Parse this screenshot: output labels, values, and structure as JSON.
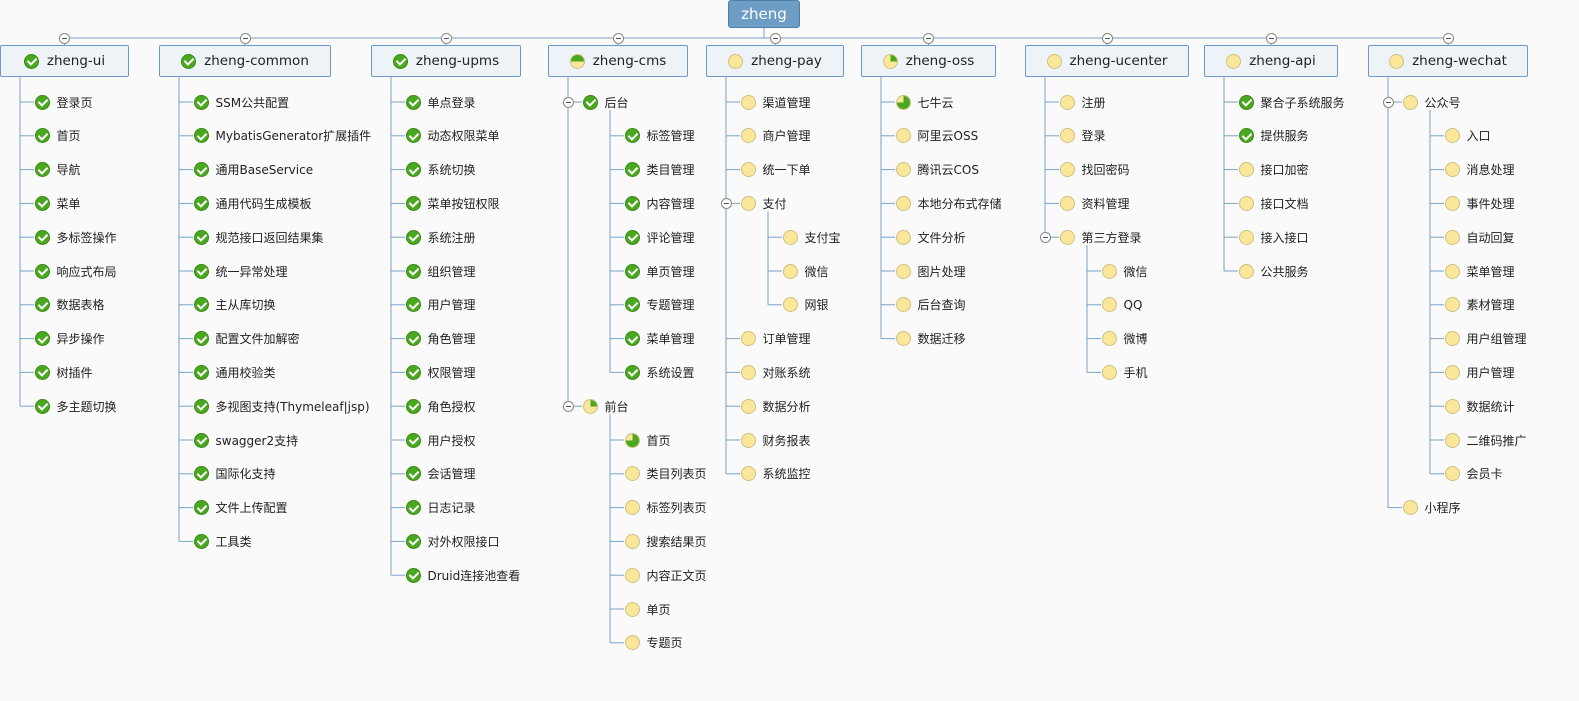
{
  "root": {
    "label": "zheng"
  },
  "branches": [
    {
      "label": "zheng-ui",
      "status": "c",
      "children": [
        {
          "label": "登录页",
          "status": "c"
        },
        {
          "label": "首页",
          "status": "c"
        },
        {
          "label": "导航",
          "status": "c"
        },
        {
          "label": "菜单",
          "status": "c"
        },
        {
          "label": "多标签操作",
          "status": "c"
        },
        {
          "label": "响应式布局",
          "status": "c"
        },
        {
          "label": "数据表格",
          "status": "c"
        },
        {
          "label": "异步操作",
          "status": "c"
        },
        {
          "label": "树插件",
          "status": "c"
        },
        {
          "label": "多主题切换",
          "status": "c"
        }
      ]
    },
    {
      "label": "zheng-common",
      "status": "c",
      "children": [
        {
          "label": "SSM公共配置",
          "status": "c"
        },
        {
          "label": "MybatisGenerator扩展插件",
          "status": "c"
        },
        {
          "label": "通用BaseService",
          "status": "c"
        },
        {
          "label": "通用代码生成模板",
          "status": "c"
        },
        {
          "label": "规范接口返回结果集",
          "status": "c"
        },
        {
          "label": "统一异常处理",
          "status": "c"
        },
        {
          "label": "主从库切换",
          "status": "c"
        },
        {
          "label": "配置文件加解密",
          "status": "c"
        },
        {
          "label": "通用校验类",
          "status": "c"
        },
        {
          "label": "多视图支持(Thymeleaf|jsp)",
          "status": "c"
        },
        {
          "label": "swagger2支持",
          "status": "c"
        },
        {
          "label": "国际化支持",
          "status": "c"
        },
        {
          "label": "文件上传配置",
          "status": "c"
        },
        {
          "label": "工具类",
          "status": "c"
        }
      ]
    },
    {
      "label": "zheng-upms",
      "status": "c",
      "children": [
        {
          "label": "单点登录",
          "status": "c"
        },
        {
          "label": "动态权限菜单",
          "status": "c"
        },
        {
          "label": "系统切换",
          "status": "c"
        },
        {
          "label": "菜单按钮权限",
          "status": "c"
        },
        {
          "label": "系统注册",
          "status": "c"
        },
        {
          "label": "组织管理",
          "status": "c"
        },
        {
          "label": "用户管理",
          "status": "c"
        },
        {
          "label": "角色管理",
          "status": "c"
        },
        {
          "label": "权限管理",
          "status": "c"
        },
        {
          "label": "角色授权",
          "status": "c"
        },
        {
          "label": "用户授权",
          "status": "c"
        },
        {
          "label": "会话管理",
          "status": "c"
        },
        {
          "label": "日志记录",
          "status": "c"
        },
        {
          "label": "对外权限接口",
          "status": "c"
        },
        {
          "label": "Druid连接池查看",
          "status": "c"
        }
      ]
    },
    {
      "label": "zheng-cms",
      "status": "h",
      "children": [
        {
          "label": "后台",
          "status": "c",
          "children": [
            {
              "label": "标签管理",
              "status": "c"
            },
            {
              "label": "类目管理",
              "status": "c"
            },
            {
              "label": "内容管理",
              "status": "c"
            },
            {
              "label": "评论管理",
              "status": "c"
            },
            {
              "label": "单页管理",
              "status": "c"
            },
            {
              "label": "专题管理",
              "status": "c"
            },
            {
              "label": "菜单管理",
              "status": "c"
            },
            {
              "label": "系统设置",
              "status": "c"
            }
          ]
        },
        {
          "label": "前台",
          "status": "q",
          "children": [
            {
              "label": "首页",
              "status": "t"
            },
            {
              "label": "类目列表页",
              "status": "y"
            },
            {
              "label": "标签列表页",
              "status": "y"
            },
            {
              "label": "搜索结果页",
              "status": "y"
            },
            {
              "label": "内容正文页",
              "status": "y"
            },
            {
              "label": "单页",
              "status": "y"
            },
            {
              "label": "专题页",
              "status": "y"
            }
          ]
        }
      ]
    },
    {
      "label": "zheng-pay",
      "status": "y",
      "children": [
        {
          "label": "渠道管理",
          "status": "y"
        },
        {
          "label": "商户管理",
          "status": "y"
        },
        {
          "label": "统一下单",
          "status": "y"
        },
        {
          "label": "支付",
          "status": "y",
          "children": [
            {
              "label": "支付宝",
              "status": "y"
            },
            {
              "label": "微信",
              "status": "y"
            },
            {
              "label": "网银",
              "status": "y"
            }
          ]
        },
        {
          "label": "订单管理",
          "status": "y"
        },
        {
          "label": "对账系统",
          "status": "y"
        },
        {
          "label": "数据分析",
          "status": "y"
        },
        {
          "label": "财务报表",
          "status": "y"
        },
        {
          "label": "系统监控",
          "status": "y"
        }
      ]
    },
    {
      "label": "zheng-oss",
      "status": "q",
      "children": [
        {
          "label": "七牛云",
          "status": "t"
        },
        {
          "label": "阿里云OSS",
          "status": "y"
        },
        {
          "label": "腾讯云COS",
          "status": "y"
        },
        {
          "label": "本地分布式存储",
          "status": "y"
        },
        {
          "label": "文件分析",
          "status": "y"
        },
        {
          "label": "图片处理",
          "status": "y"
        },
        {
          "label": "后台查询",
          "status": "y"
        },
        {
          "label": "数据迁移",
          "status": "y"
        }
      ]
    },
    {
      "label": "zheng-ucenter",
      "status": "y",
      "children": [
        {
          "label": "注册",
          "status": "y"
        },
        {
          "label": "登录",
          "status": "y"
        },
        {
          "label": "找回密码",
          "status": "y"
        },
        {
          "label": "资料管理",
          "status": "y"
        },
        {
          "label": "第三方登录",
          "status": "y",
          "children": [
            {
              "label": "微信",
              "status": "y"
            },
            {
              "label": "QQ",
              "status": "y"
            },
            {
              "label": "微博",
              "status": "y"
            },
            {
              "label": "手机",
              "status": "y"
            }
          ]
        }
      ]
    },
    {
      "label": "zheng-api",
      "status": "y",
      "children": [
        {
          "label": "聚合子系统服务",
          "status": "c"
        },
        {
          "label": "提供服务",
          "status": "c"
        },
        {
          "label": "接口加密",
          "status": "y"
        },
        {
          "label": "接口文档",
          "status": "y"
        },
        {
          "label": "接入接口",
          "status": "y"
        },
        {
          "label": "公共服务",
          "status": "y"
        }
      ]
    },
    {
      "label": "zheng-wechat",
      "status": "y",
      "children": [
        {
          "label": "公众号",
          "status": "y",
          "children": [
            {
              "label": "入口",
              "status": "y"
            },
            {
              "label": "消息处理",
              "status": "y"
            },
            {
              "label": "事件处理",
              "status": "y"
            },
            {
              "label": "自动回复",
              "status": "y"
            },
            {
              "label": "菜单管理",
              "status": "y"
            },
            {
              "label": "素材管理",
              "status": "y"
            },
            {
              "label": "用户组管理",
              "status": "y"
            },
            {
              "label": "用户管理",
              "status": "y"
            },
            {
              "label": "数据统计",
              "status": "y"
            },
            {
              "label": "二维码推广",
              "status": "y"
            },
            {
              "label": "会员卡",
              "status": "y"
            }
          ]
        },
        {
          "label": "小程序",
          "status": "y"
        }
      ]
    }
  ]
}
